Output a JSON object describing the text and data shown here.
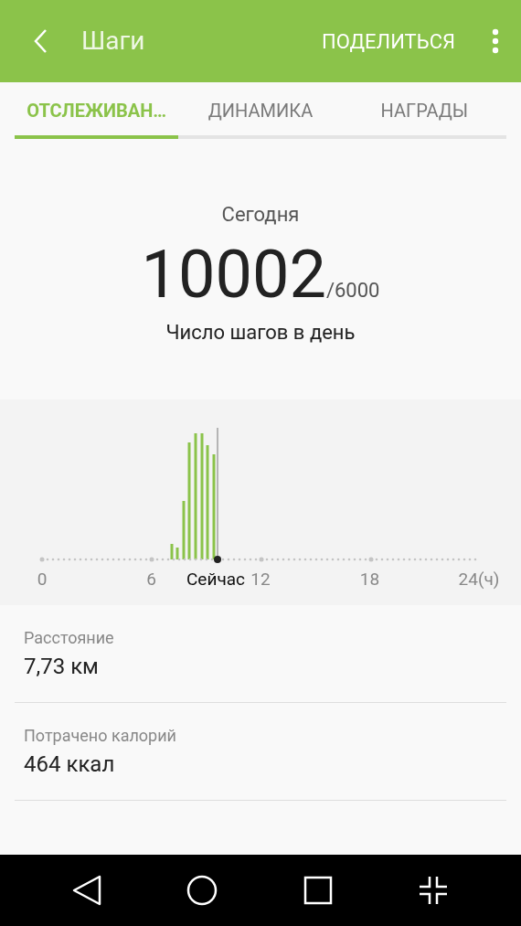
{
  "app_bar": {
    "title": "Шаги",
    "action": "ПОДЕЛИТЬСЯ"
  },
  "tabs": [
    {
      "label": "ОТСЛЕЖИВАН…",
      "selected": true
    },
    {
      "label": "ДИНАМИКА",
      "selected": false
    },
    {
      "label": "НАГРАДЫ",
      "selected": false
    }
  ],
  "summary": {
    "period": "Сегодня",
    "steps": "10002",
    "goal": "/6000",
    "caption": "Число шагов в день"
  },
  "activity_graph": {
    "axis_labels": [
      "0",
      "6",
      "12",
      "18",
      "24(ч)"
    ],
    "now_label": "Сейчас"
  },
  "stats": [
    {
      "label": "Расстояние",
      "value": "7,73 км"
    },
    {
      "label": "Потрачено калорий",
      "value": "464 ккал"
    }
  ]
}
